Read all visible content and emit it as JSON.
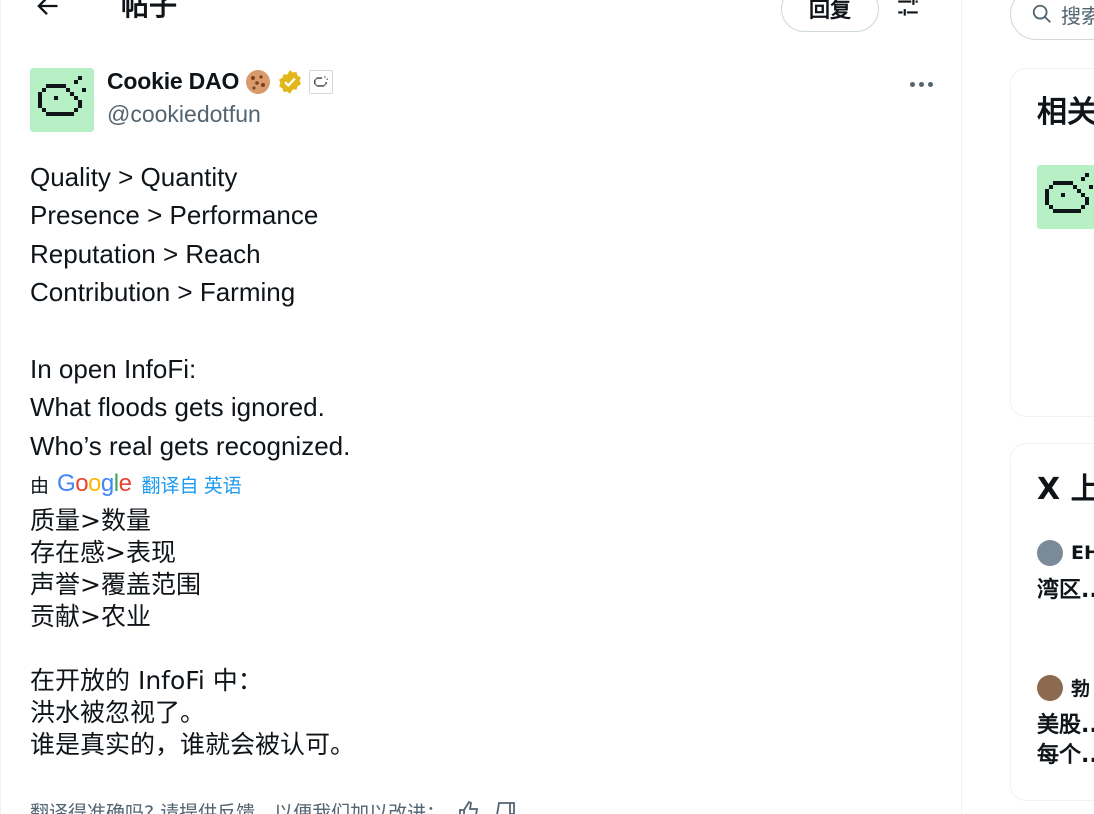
{
  "header": {
    "title": "帖子",
    "reply_label": "回复"
  },
  "author": {
    "name": "Cookie DAO",
    "handle": "@cookiedotfun"
  },
  "tweet": {
    "en_lines": [
      "Quality > Quantity",
      "Presence > Performance",
      "Reputation > Reach",
      "Contribution > Farming",
      "",
      "In open InfoFi:",
      "What floods gets ignored.",
      "Who’s real gets recognized."
    ],
    "translation": {
      "by_label": "由",
      "provider": "Google",
      "link_label": "翻译自 英语"
    },
    "zh_lines": [
      "质量>数量",
      "存在感>表现",
      "声誉>覆盖范围",
      "贡献>农业",
      "",
      "在开放的 InfoFi 中：",
      "洪水被忽视了。",
      "谁是真实的，谁就会被认可。"
    ],
    "feedback_text": "翻译得准确吗? 请提供反馈，以便我们加以改进："
  },
  "sidebar": {
    "search_placeholder": "搜索",
    "card1_title": "相关",
    "card2_title": "X 上",
    "trends": [
      {
        "user": "EH",
        "text": "湾区..."
      },
      {
        "user": "勃",
        "text": "美股...",
        "text2": "每个..."
      }
    ]
  }
}
